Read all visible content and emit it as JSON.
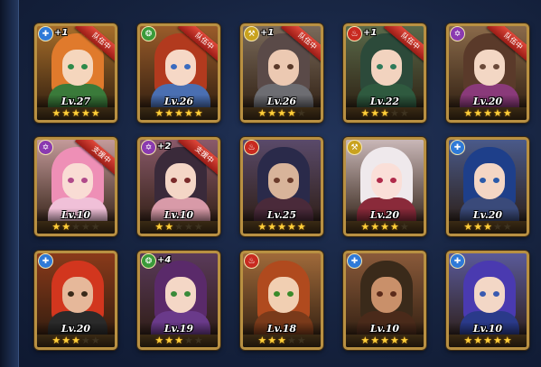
{
  "heroes": [
    {
      "level": "Lv.27",
      "stars": 5,
      "plus": "+1",
      "ribbon": "队伍中",
      "element": "blue",
      "hair": "#e07a2c",
      "skin": "#f5d6bd",
      "eye": "#2e8a4a",
      "outfit": "#3a7a3a",
      "bg": "#a66d2a"
    },
    {
      "level": "Lv.26",
      "stars": 5,
      "plus": "",
      "ribbon": "队伍中",
      "element": "green",
      "hair": "#b23a1e",
      "skin": "#f6d8c6",
      "eye": "#3a6bbf",
      "outfit": "#4a6fb2",
      "bg": "#9a5c2a"
    },
    {
      "level": "Lv.26",
      "stars": 4,
      "plus": "+1",
      "ribbon": "队伍中",
      "element": "yellow",
      "hair": "#5a4a48",
      "skin": "#ecc9b2",
      "eye": "#5a3a2a",
      "outfit": "#6d6d72",
      "bg": "#7a6a5a"
    },
    {
      "level": "Lv.22",
      "stars": 3,
      "plus": "+1",
      "ribbon": "队伍中",
      "element": "red",
      "hair": "#2c4a3a",
      "skin": "#f2d3bf",
      "eye": "#2f7a5a",
      "outfit": "#2f5a3f",
      "bg": "#5a6a4a"
    },
    {
      "level": "Lv.20",
      "stars": 5,
      "plus": "",
      "ribbon": "队伍中",
      "element": "purple",
      "hair": "#5a3a2a",
      "skin": "#f3d7c4",
      "eye": "#6a4a3a",
      "outfit": "#8a3a7a",
      "bg": "#8a6a4a"
    },
    {
      "level": "Lv.10",
      "stars": 2,
      "plus": "",
      "ribbon": "支援中",
      "element": "purple",
      "hair": "#ee8fb6",
      "skin": "#f9dcd4",
      "eye": "#b04a8a",
      "outfit": "#f0c0d8",
      "bg": "#c49a9a"
    },
    {
      "level": "Lv.10",
      "stars": 2,
      "plus": "+2",
      "ribbon": "支援中",
      "element": "purple",
      "hair": "#3a2a3a",
      "skin": "#f4d6c6",
      "eye": "#7a2a2a",
      "outfit": "#d89aa8",
      "bg": "#8a5a6a"
    },
    {
      "level": "Lv.25",
      "stars": 5,
      "plus": "",
      "ribbon": "",
      "element": "red",
      "hair": "#2a2a4a",
      "skin": "#d8b49a",
      "eye": "#6a3a2a",
      "outfit": "#4a2a3a",
      "bg": "#5a4a6a"
    },
    {
      "level": "Lv.20",
      "stars": 4,
      "plus": "",
      "ribbon": "",
      "element": "yellow",
      "hair": "#efe9ec",
      "skin": "#fadfd8",
      "eye": "#b02a4a",
      "outfit": "#8a2a3a",
      "bg": "#c9b7b7"
    },
    {
      "level": "Lv.20",
      "stars": 3,
      "plus": "",
      "ribbon": "",
      "element": "blue",
      "hair": "#1e3f8a",
      "skin": "#f4d6c4",
      "eye": "#2a5aaa",
      "outfit": "#3a4a7a",
      "bg": "#4a5a8a"
    },
    {
      "level": "Lv.20",
      "stars": 3,
      "plus": "",
      "ribbon": "",
      "element": "blue",
      "hair": "#d2361e",
      "skin": "#e6b89a",
      "eye": "#3a2a1a",
      "outfit": "#2a2a2a",
      "bg": "#8a3a1a"
    },
    {
      "level": "Lv.19",
      "stars": 3,
      "plus": "+4",
      "ribbon": "",
      "element": "green",
      "hair": "#5a2a6a",
      "skin": "#f4d7c6",
      "eye": "#3a8a3a",
      "outfit": "#6a3a8a",
      "bg": "#5a3a5a"
    },
    {
      "level": "Lv.18",
      "stars": 3,
      "plus": "",
      "ribbon": "",
      "element": "red",
      "hair": "#b04a1e",
      "skin": "#f1cfb2",
      "eye": "#3a8a2a",
      "outfit": "#7a3a1a",
      "bg": "#a06a3a"
    },
    {
      "level": "Lv.10",
      "stars": 5,
      "plus": "",
      "ribbon": "",
      "element": "blue",
      "hair": "#3a2a1a",
      "skin": "#c9906a",
      "eye": "#5a2a1a",
      "outfit": "#4a2a1a",
      "bg": "#8a5a3a"
    },
    {
      "level": "Lv.10",
      "stars": 5,
      "plus": "",
      "ribbon": "",
      "element": "blue",
      "hair": "#4a3ab0",
      "skin": "#f3d7c6",
      "eye": "#3a5ab0",
      "outfit": "#2a3a8a",
      "bg": "#5a5a9a"
    }
  ],
  "element_colors": {
    "blue": "#2f7ad8",
    "green": "#3a9a3a",
    "yellow": "#c9a21e",
    "red": "#c82a20",
    "purple": "#8a3ab0"
  },
  "element_glyphs": {
    "blue": "✚",
    "green": "❂",
    "yellow": "⚒",
    "red": "♨",
    "purple": "✡"
  }
}
